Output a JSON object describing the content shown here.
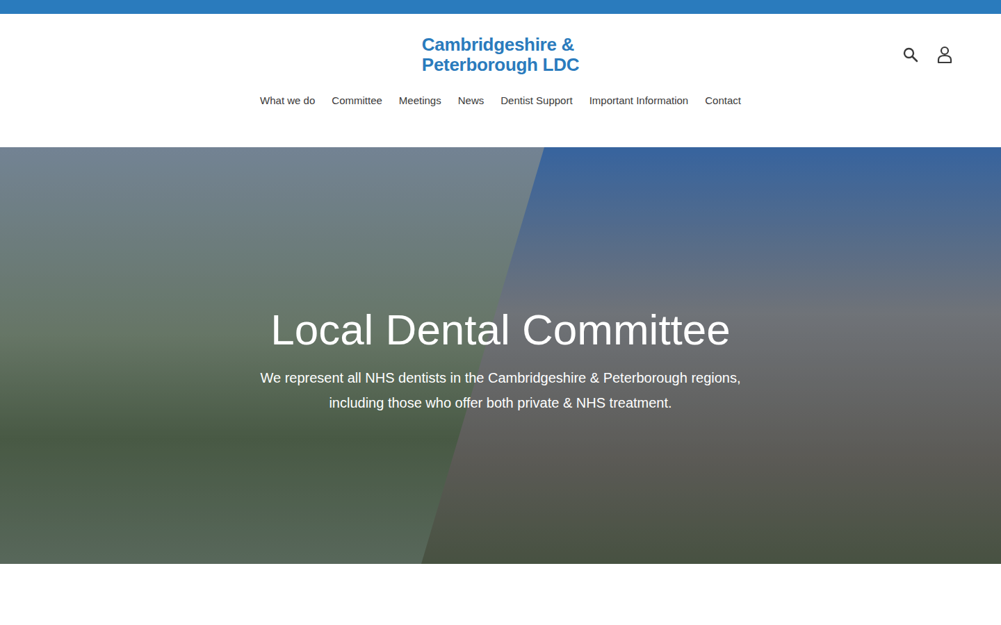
{
  "logo": {
    "lines": [
      "Cambridgeshire &",
      "Peterborough LDC"
    ]
  },
  "nav": [
    {
      "label": "What we do"
    },
    {
      "label": "Committee"
    },
    {
      "label": "Meetings"
    },
    {
      "label": "News"
    },
    {
      "label": "Dentist Support"
    },
    {
      "label": "Important Information"
    },
    {
      "label": "Contact"
    }
  ],
  "hero": {
    "title": "Local Dental Committee",
    "subtitle_lines": [
      "We represent all NHS dentists in the Cambridgeshire & Peterborough regions,",
      "including those who offer both private & NHS treatment."
    ]
  }
}
